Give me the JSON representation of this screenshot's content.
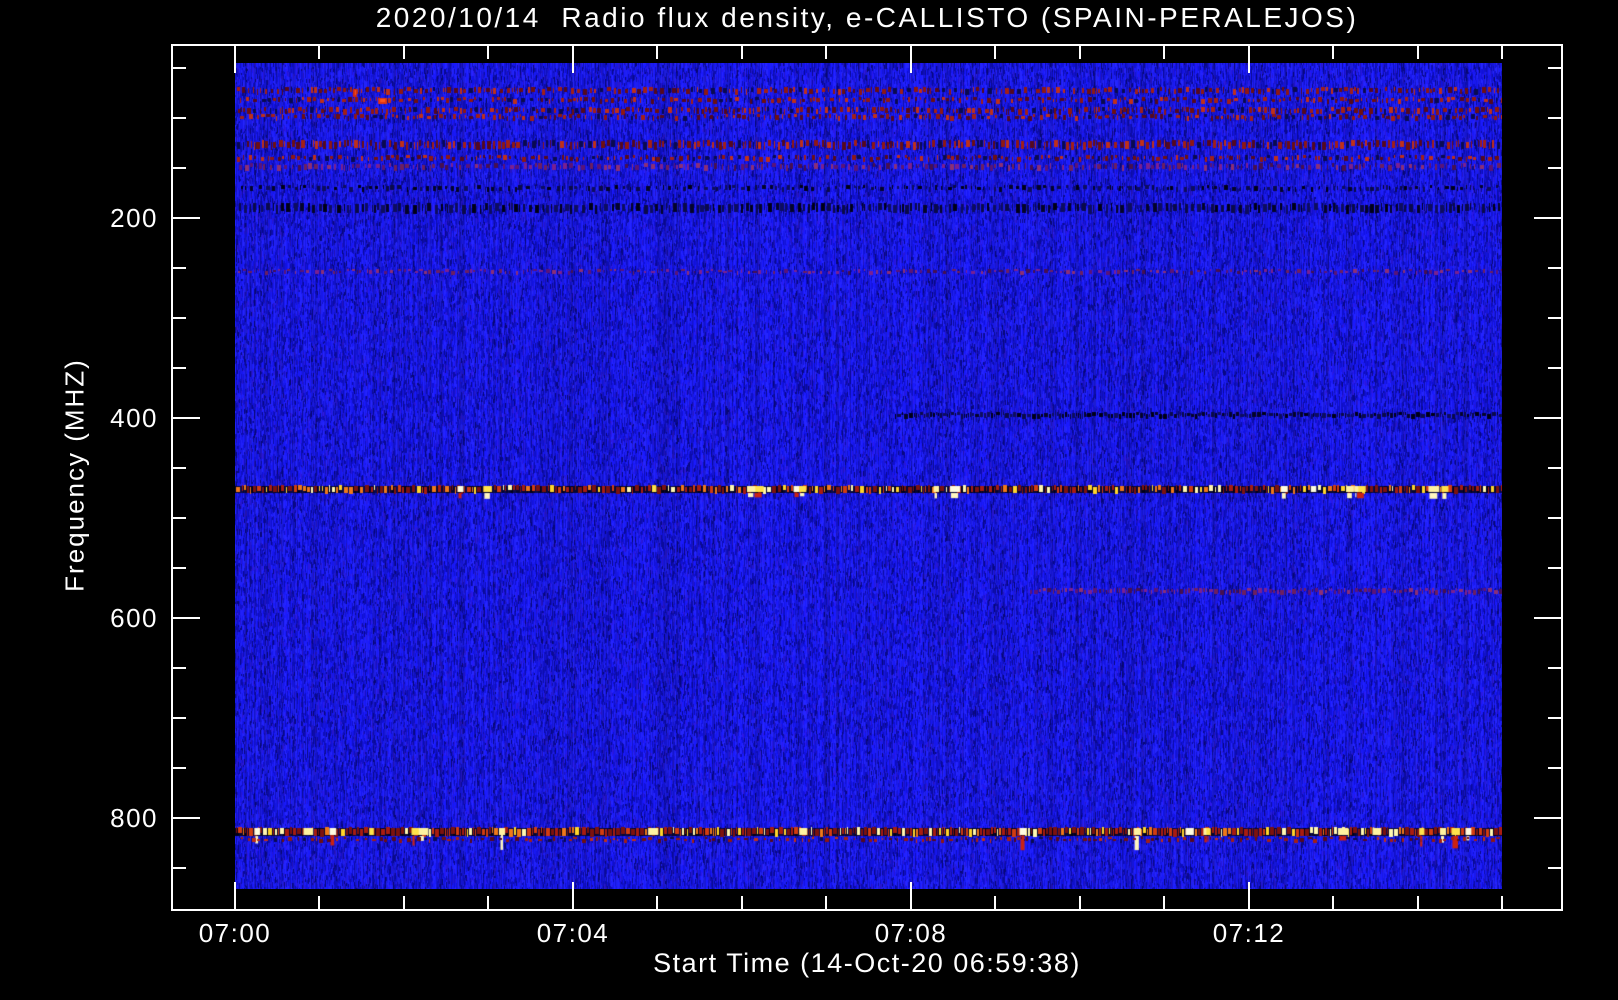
{
  "colors": {
    "background": "#000000",
    "frame": "#ffffff",
    "text": "#ffffff",
    "plot_base_blue": "#1a1ae0"
  },
  "chart_data": {
    "type": "heatmap",
    "title": "2020/10/14  Radio flux density, e-CALLISTO (SPAIN-PERALEJOS)",
    "xlabel": "Start Time (14-Oct-20 06:59:38)",
    "ylabel": "Frequency (MHZ)",
    "legend": "none",
    "grid": false,
    "x_axis": {
      "unit": "time",
      "range_minutes": [
        0,
        15
      ],
      "major_ticks": [
        {
          "minute": 0,
          "label": "07:00"
        },
        {
          "minute": 4,
          "label": "07:04"
        },
        {
          "minute": 8,
          "label": "07:08"
        },
        {
          "minute": 12,
          "label": "07:12"
        }
      ],
      "minor_step_minutes": 1
    },
    "y_axis": {
      "unit": "MHz",
      "range_mhz": [
        45,
        871
      ],
      "inverted": true,
      "major_ticks": [
        200,
        400,
        600,
        800
      ],
      "minor_step_mhz": 50
    },
    "palettes": {
      "base_blue": [
        [
          24,
          24,
          238
        ],
        [
          34,
          34,
          252
        ],
        [
          16,
          16,
          200
        ],
        [
          12,
          12,
          165
        ],
        [
          40,
          22,
          210
        ],
        [
          8,
          8,
          130
        ]
      ],
      "base_weights": [
        0.3,
        0.25,
        0.2,
        0.12,
        0.08,
        0.05
      ],
      "red": [
        "#6e1010",
        "#8f1812",
        "#a32015",
        "#55091e",
        "#0a0a50",
        "#c03018"
      ],
      "dark": [
        "#04042a",
        "#0a0a4a",
        "#0d0d60",
        "#000018"
      ],
      "purple": [
        "#5a1478",
        "#7a2090",
        "#8b2f75",
        "#47104f",
        "#6d1f5f"
      ],
      "fire": [
        "#7c120e",
        "#a81c10",
        "#d23c10",
        "#f07818",
        "#ffd42a",
        "#fff7b0"
      ],
      "bright": [
        "#ffe24a",
        "#fff2a0",
        "#fffce0"
      ],
      "band_base": "#060630"
    },
    "interference_bands": [
      {
        "name": "rfi-70mhz",
        "freq": 70,
        "h": 6,
        "density": 0.5,
        "palette": "red"
      },
      {
        "name": "rfi-80mhz",
        "freq": 80,
        "h": 5,
        "density": 0.38,
        "palette": "red"
      },
      {
        "name": "rfi-90mhz",
        "freq": 90,
        "h": 6,
        "density": 0.55,
        "palette": "red"
      },
      {
        "name": "rfi-97mhz",
        "freq": 97,
        "h": 5,
        "density": 0.35,
        "palette": "red"
      },
      {
        "name": "rfi-123mhz",
        "freq": 123,
        "h": 8,
        "density": 0.6,
        "palette": "red"
      },
      {
        "name": "rfi-138mhz",
        "freq": 138,
        "h": 5,
        "density": 0.42,
        "palette": "red"
      },
      {
        "name": "rfi-146mhz",
        "freq": 146,
        "h": 6,
        "density": 0.4,
        "palette": "purple"
      },
      {
        "name": "rfi-168mhz",
        "freq": 168,
        "h": 5,
        "density": 0.28,
        "palette": "dark"
      },
      {
        "name": "rfi-186mhz",
        "freq": 186,
        "h": 9,
        "density": 0.55,
        "palette": "dark"
      },
      {
        "name": "rfi-252mhz",
        "freq": 252,
        "h": 4,
        "density": 0.22,
        "palette": "purple"
      },
      {
        "name": "rfi-395mhz-right",
        "freq": 395,
        "h": 5,
        "density": 0.85,
        "palette": "dark",
        "x0": 0.52,
        "x1": 1.0
      },
      {
        "name": "rfi-468mhz",
        "freq": 468,
        "h": 7,
        "density": 0.8,
        "palette": "fire",
        "base": true,
        "blobs": 16,
        "blob_below": 3
      },
      {
        "name": "rfi-571mhz-right",
        "freq": 571,
        "h": 5,
        "density": 0.8,
        "palette": "purple",
        "x0": 0.626,
        "x1": 1.0
      },
      {
        "name": "rfi-810mhz",
        "freq": 810,
        "h": 8,
        "density": 0.88,
        "palette": "fire",
        "base": true,
        "blobs": 22,
        "blob_below": 12
      },
      {
        "name": "rfi-820mhz",
        "freq": 820,
        "h": 4,
        "density": 0.3,
        "palette": "red"
      }
    ],
    "features": [
      {
        "name": "red-burst-spot",
        "freq": 80,
        "x": 0.113,
        "w": 9,
        "h": 6,
        "color": "#e23510"
      },
      {
        "name": "red-burst-spot2",
        "freq": 71,
        "x": 0.093,
        "w": 4,
        "h": 8,
        "color": "#d02810"
      }
    ]
  }
}
